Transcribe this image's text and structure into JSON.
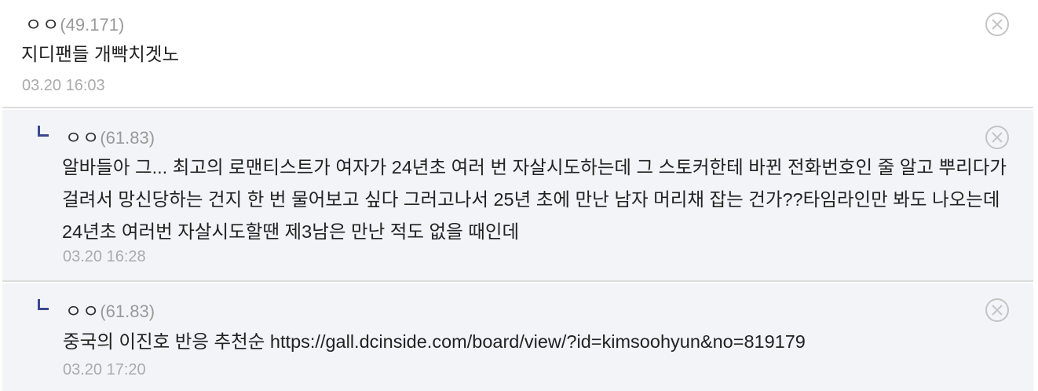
{
  "comments": [
    {
      "nickname": "ㅇㅇ",
      "ip": "(49.171)",
      "text": "지디팬들 개빡치겟노",
      "date": "03.20 16:03",
      "delete_icon": "close-circle-icon"
    },
    {
      "nickname": "ㅇㅇ",
      "ip": "(61.83)",
      "text": "알바들아 그... 최고의 로맨티스트가 여자가 24년초 여러 번 자살시도하는데 그 스토커한테 바뀐 전화번호인 줄 알고 뿌리다가 걸려서 망신당하는 건지 한 번 물어보고 싶다 그러고나서 25년 초에 만난 남자 머리채 잡는 건가??타임라인만 봐도 나오는데 24년초 여러번 자살시도할땐 제3남은 만난 적도 없을 때인데",
      "date": "03.20 16:28",
      "reply_icon": "reply-arrow-icon",
      "delete_icon": "close-circle-icon"
    },
    {
      "nickname": "ㅇㅇ",
      "ip": "(61.83)",
      "text": "중국의 이진호 반응 추천순 https://gall.dcinside.com/board/view/?id=kimsoohyun&no=819179",
      "date": "03.20 17:20",
      "reply_icon": "reply-arrow-icon",
      "delete_icon": "close-circle-icon"
    }
  ],
  "colors": {
    "reply_bg": "#f3f4f7",
    "reply_icon": "#3b4890",
    "divider": "#dcdcdc",
    "date": "#aaaaaa"
  }
}
